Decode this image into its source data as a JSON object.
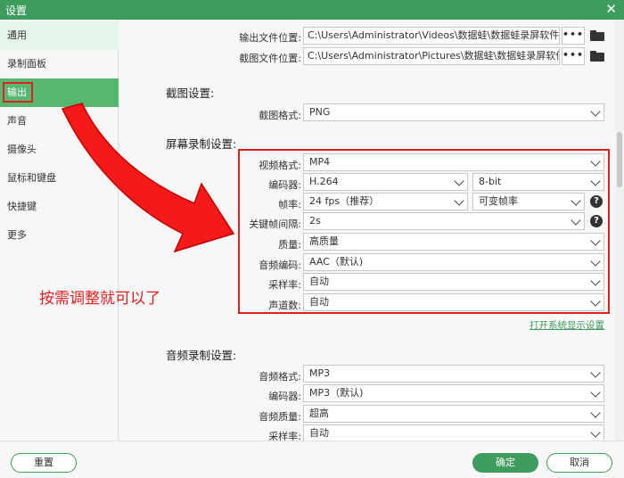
{
  "window": {
    "title": "设置",
    "close_symbol": "✕"
  },
  "sidebar": {
    "items": [
      {
        "label": "通用"
      },
      {
        "label": "录制面板"
      },
      {
        "label": "输出"
      },
      {
        "label": "声音"
      },
      {
        "label": "摄像头"
      },
      {
        "label": "鼠标和键盘"
      },
      {
        "label": "快捷键"
      },
      {
        "label": "更多"
      }
    ]
  },
  "output": {
    "output_path_label": "输出文件位置:",
    "output_path_value": "C:\\Users\\Administrator\\Videos\\数据蛙\\数据蛙录屏软件",
    "screenshot_path_label": "截图文件位置:",
    "screenshot_path_value": "C:\\Users\\Administrator\\Pictures\\数据蛙\\数据蛙录屏软件",
    "dots": "•••"
  },
  "screenshot_settings": {
    "title": "截图设置:",
    "format_label": "截图格式:",
    "format_value": "PNG"
  },
  "screen_record": {
    "title": "屏幕录制设置:",
    "video_format_label": "视频格式:",
    "video_format_value": "MP4",
    "encoder_label": "编码器:",
    "encoder_value": "H.264",
    "bitdepth_value": "8-bit",
    "framerate_label": "帧率:",
    "framerate_value": "24 fps（推荐）",
    "framerate_mode_value": "可变帧率",
    "keyframe_label": "关键帧间隔:",
    "keyframe_value": "2s",
    "quality_label": "质量:",
    "quality_value": "高质量",
    "audio_codec_label": "音频编码:",
    "audio_codec_value": "AAC（默认)",
    "samplerate_label": "采样率:",
    "samplerate_value": "自动",
    "channels_label": "声道数:",
    "channels_value": "自动",
    "display_link": "打开系统显示设置",
    "help_symbol": "?"
  },
  "audio_record": {
    "title": "音频录制设置:",
    "format_label": "音频格式:",
    "format_value": "MP3",
    "encoder_label": "编码器:",
    "encoder_value": "MP3（默认)",
    "quality_label": "音频质量:",
    "quality_value": "超高",
    "samplerate_label": "采样率:",
    "samplerate_value": "自动"
  },
  "annotation": {
    "text": "按需调整就可以了"
  },
  "footer": {
    "reset": "重置",
    "ok": "确定",
    "cancel": "取消"
  },
  "colors": {
    "accent": "#3d9c5e",
    "sidebar_active": "#56b870",
    "annotation_red": "#e02020"
  }
}
